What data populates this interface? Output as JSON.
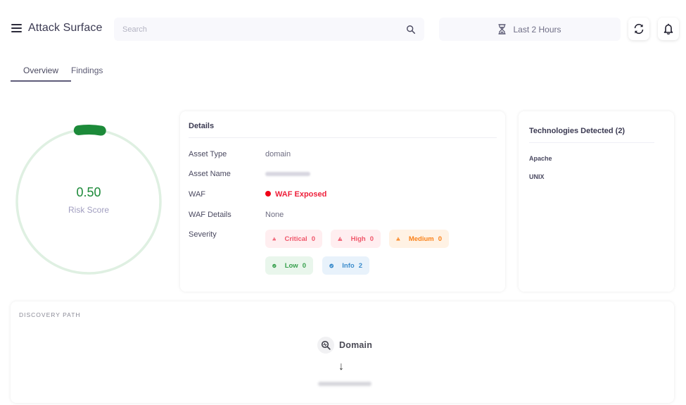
{
  "header": {
    "title": "Attack Surface",
    "search_placeholder": "Search",
    "search_value": "",
    "time_range": "Last 2 Hours",
    "icons": {
      "menu": "hamburger-menu-icon",
      "search": "search-icon",
      "time": "hourglass-icon",
      "refresh": "refresh-icon",
      "notifications": "bell-icon"
    }
  },
  "tabs": [
    {
      "label": "Overview",
      "active": true
    },
    {
      "label": "Findings",
      "active": false
    }
  ],
  "risk": {
    "score": "0.50",
    "label": "Risk Score",
    "fraction": 0.05,
    "color": "#1c8a39",
    "track_color": "#dff0e2"
  },
  "details": {
    "title": "Details",
    "rows": [
      {
        "key": "Asset Type",
        "value": "domain"
      },
      {
        "key": "Asset Name",
        "value": ""
      },
      {
        "key": "WAF",
        "value": "WAF Exposed"
      },
      {
        "key": "WAF Details",
        "value": "None"
      },
      {
        "key": "Severity",
        "value": ""
      }
    ],
    "waf_status_color": "#f00016",
    "severity": [
      {
        "label": "Critical",
        "count": "0",
        "icon": "warning-triangle-icon",
        "color": "#f0566a"
      },
      {
        "label": "High",
        "count": "0",
        "icon": "warning-triangle-icon",
        "color": "#f0566a"
      },
      {
        "label": "Medium",
        "count": "0",
        "icon": "warning-triangle-icon",
        "color": "#fa8119"
      },
      {
        "label": "Low",
        "count": "0",
        "icon": "check-circle-icon",
        "color": "#37a04d"
      },
      {
        "label": "Info",
        "count": "2",
        "icon": "check-circle-icon",
        "color": "#3b8ccc"
      }
    ]
  },
  "technologies": {
    "title": "Technologies Detected (2)",
    "items": [
      "Apache",
      "UNIX"
    ]
  },
  "discovery": {
    "title": "DISCOVERY PATH",
    "node_label": "Domain",
    "node_icon": "zoom-search-icon",
    "arrow": "↓"
  }
}
